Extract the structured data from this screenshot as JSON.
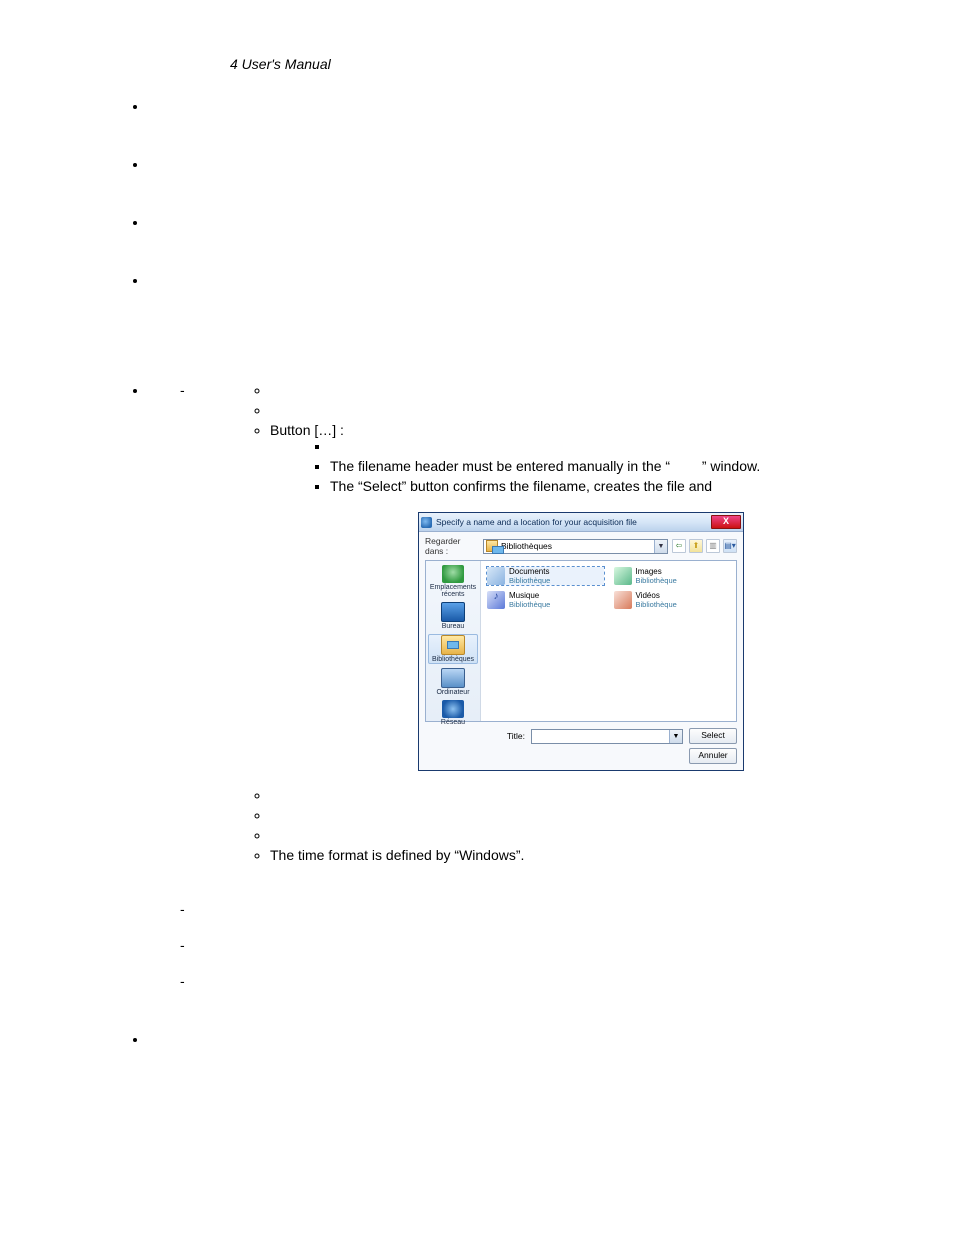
{
  "header": {
    "title": "4 User's Manual"
  },
  "text": {
    "button_line": "Button […] :",
    "sq_blank_lead": "",
    "sq_line2_a": "The filename header must be entered manually in the “",
    "sq_line2_b": "” window.",
    "sq_line3": "The “Select” button confirms the filename, creates the file and",
    "time_format": "The time format is defined by “Windows”."
  },
  "dialog": {
    "title": "Specify a name and a location for your acquisition file",
    "close": "X",
    "look_in_label": "Regarder dans :",
    "look_in_value": "Bibliothèques",
    "places": {
      "recent": "Emplacements récents",
      "desktop": "Bureau",
      "libraries": "Bibliothèques",
      "computer": "Ordinateur",
      "network": "Réseau"
    },
    "libs": {
      "docs": {
        "name": "Documents",
        "sub": "Bibliothèque"
      },
      "images": {
        "name": "Images",
        "sub": "Bibliothèque"
      },
      "music": {
        "name": "Musique",
        "sub": "Bibliothèque"
      },
      "videos": {
        "name": "Vidéos",
        "sub": "Bibliothèque"
      }
    },
    "title_label": "Title:",
    "btn_select": "Select",
    "btn_cancel": "Annuler",
    "toolbar": {
      "back": "⇦",
      "up": "⬆",
      "new": "▥",
      "views": "▤▾"
    }
  }
}
